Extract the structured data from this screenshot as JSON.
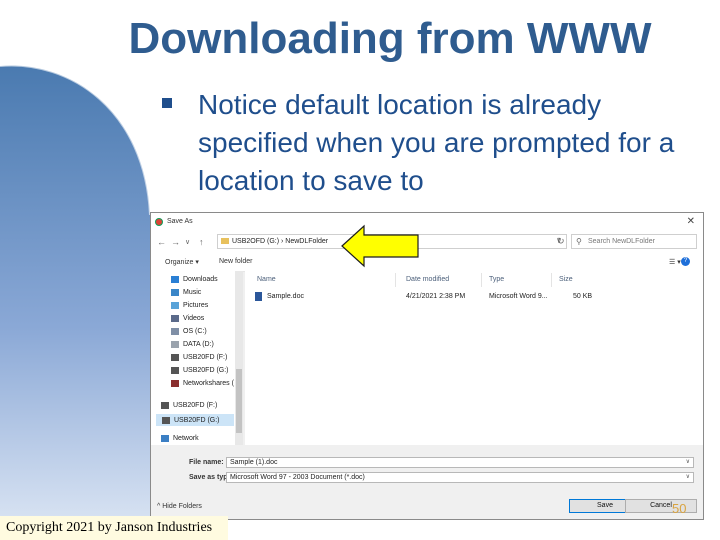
{
  "slide": {
    "title": "Downloading from WWW",
    "bullet": "Notice default location is already specified when you are prompted for a location to save to",
    "copyright": "Copyright 2021 by Janson Industries",
    "page_number": "50"
  },
  "dialog": {
    "title": "Save As",
    "close_icon": "close-icon",
    "address_path": "USB2OFD (G:) › NewDLFolder",
    "search_placeholder": "Search NewDLFolder",
    "toolbar": {
      "organize": "Organize ▾",
      "new_folder": "New folder",
      "view": "☰ ▾",
      "help": "?"
    },
    "sidebar": [
      {
        "label": "Downloads",
        "icon": "download-icon"
      },
      {
        "label": "Music",
        "icon": "music-icon"
      },
      {
        "label": "Pictures",
        "icon": "pictures-icon"
      },
      {
        "label": "Videos",
        "icon": "videos-icon"
      },
      {
        "label": "OS (C:)",
        "icon": "drive-icon"
      },
      {
        "label": "DATA (D:)",
        "icon": "drive-icon"
      },
      {
        "label": "USB20FD (F:)",
        "icon": "usb-icon"
      },
      {
        "label": "USB20FD (G:)",
        "icon": "usb-icon"
      },
      {
        "label": "Networkshares (",
        "icon": "network-drive-icon"
      },
      {
        "label": "USB20FD (F:)",
        "icon": "usb-icon"
      },
      {
        "label": "USB20FD (G:)",
        "icon": "usb-icon",
        "selected": true
      },
      {
        "label": "Network",
        "icon": "network-icon"
      }
    ],
    "columns": [
      "Name",
      "Date modified",
      "Type",
      "Size"
    ],
    "files": [
      {
        "name": "Sample.doc",
        "date": "4/21/2021 2:38 PM",
        "type": "Microsoft Word 9...",
        "size": "50 KB"
      }
    ],
    "file_name_label": "File name:",
    "file_name_value": "Sample (1).doc",
    "save_type_label": "Save as type:",
    "save_type_value": "Microsoft Word 97 - 2003 Document (*.doc)",
    "hide_folders": "Hide Folders",
    "save_button": "Save",
    "cancel_button": "Cancel"
  },
  "colors": {
    "title": "#2f5c8f",
    "bullet": "#1f4e8c",
    "arrow": "#ffff00",
    "page_number": "#d9a441"
  }
}
